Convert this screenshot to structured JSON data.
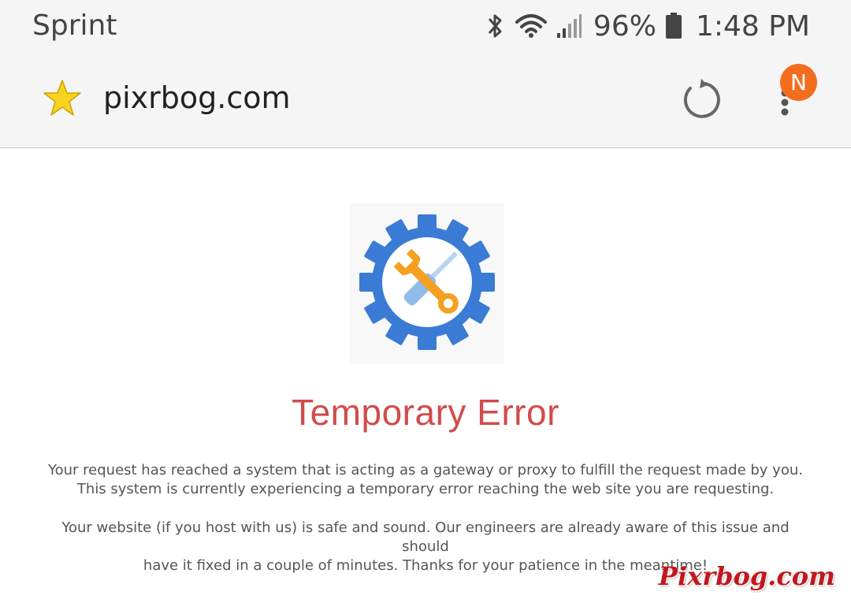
{
  "status_bar": {
    "carrier": "Sprint",
    "battery_percent": "96%",
    "time": "1:48 PM",
    "icons": [
      "bluetooth-icon",
      "wifi-icon",
      "signal-icon",
      "battery-icon"
    ]
  },
  "browser": {
    "url": "pixrbog.com",
    "notification_badge": "N",
    "icons": [
      "star-icon",
      "reload-icon",
      "more-menu-icon"
    ]
  },
  "page": {
    "title": "Temporary Error",
    "paragraph1_line1": "Your request has reached a system that is acting as a gateway or proxy to fulfill the request made by you.",
    "paragraph1_line2": "This system is currently experiencing a temporary error reaching the web site you are requesting.",
    "paragraph2_line1": "Your website (if you host with us) is safe and sound. Our engineers are already aware of this issue and should",
    "paragraph2_line2": "have it fixed in a couple of minutes. Thanks for your patience in the meantime!",
    "graphic": "gear-wrench-icon"
  },
  "watermark": "Pixrbog.com",
  "colors": {
    "title_red": "#d24b4b",
    "gear_blue": "#3a7bd5",
    "wrench_orange": "#f5a020",
    "badge_orange": "#f26d1d",
    "watermark_red": "#c0181e"
  }
}
